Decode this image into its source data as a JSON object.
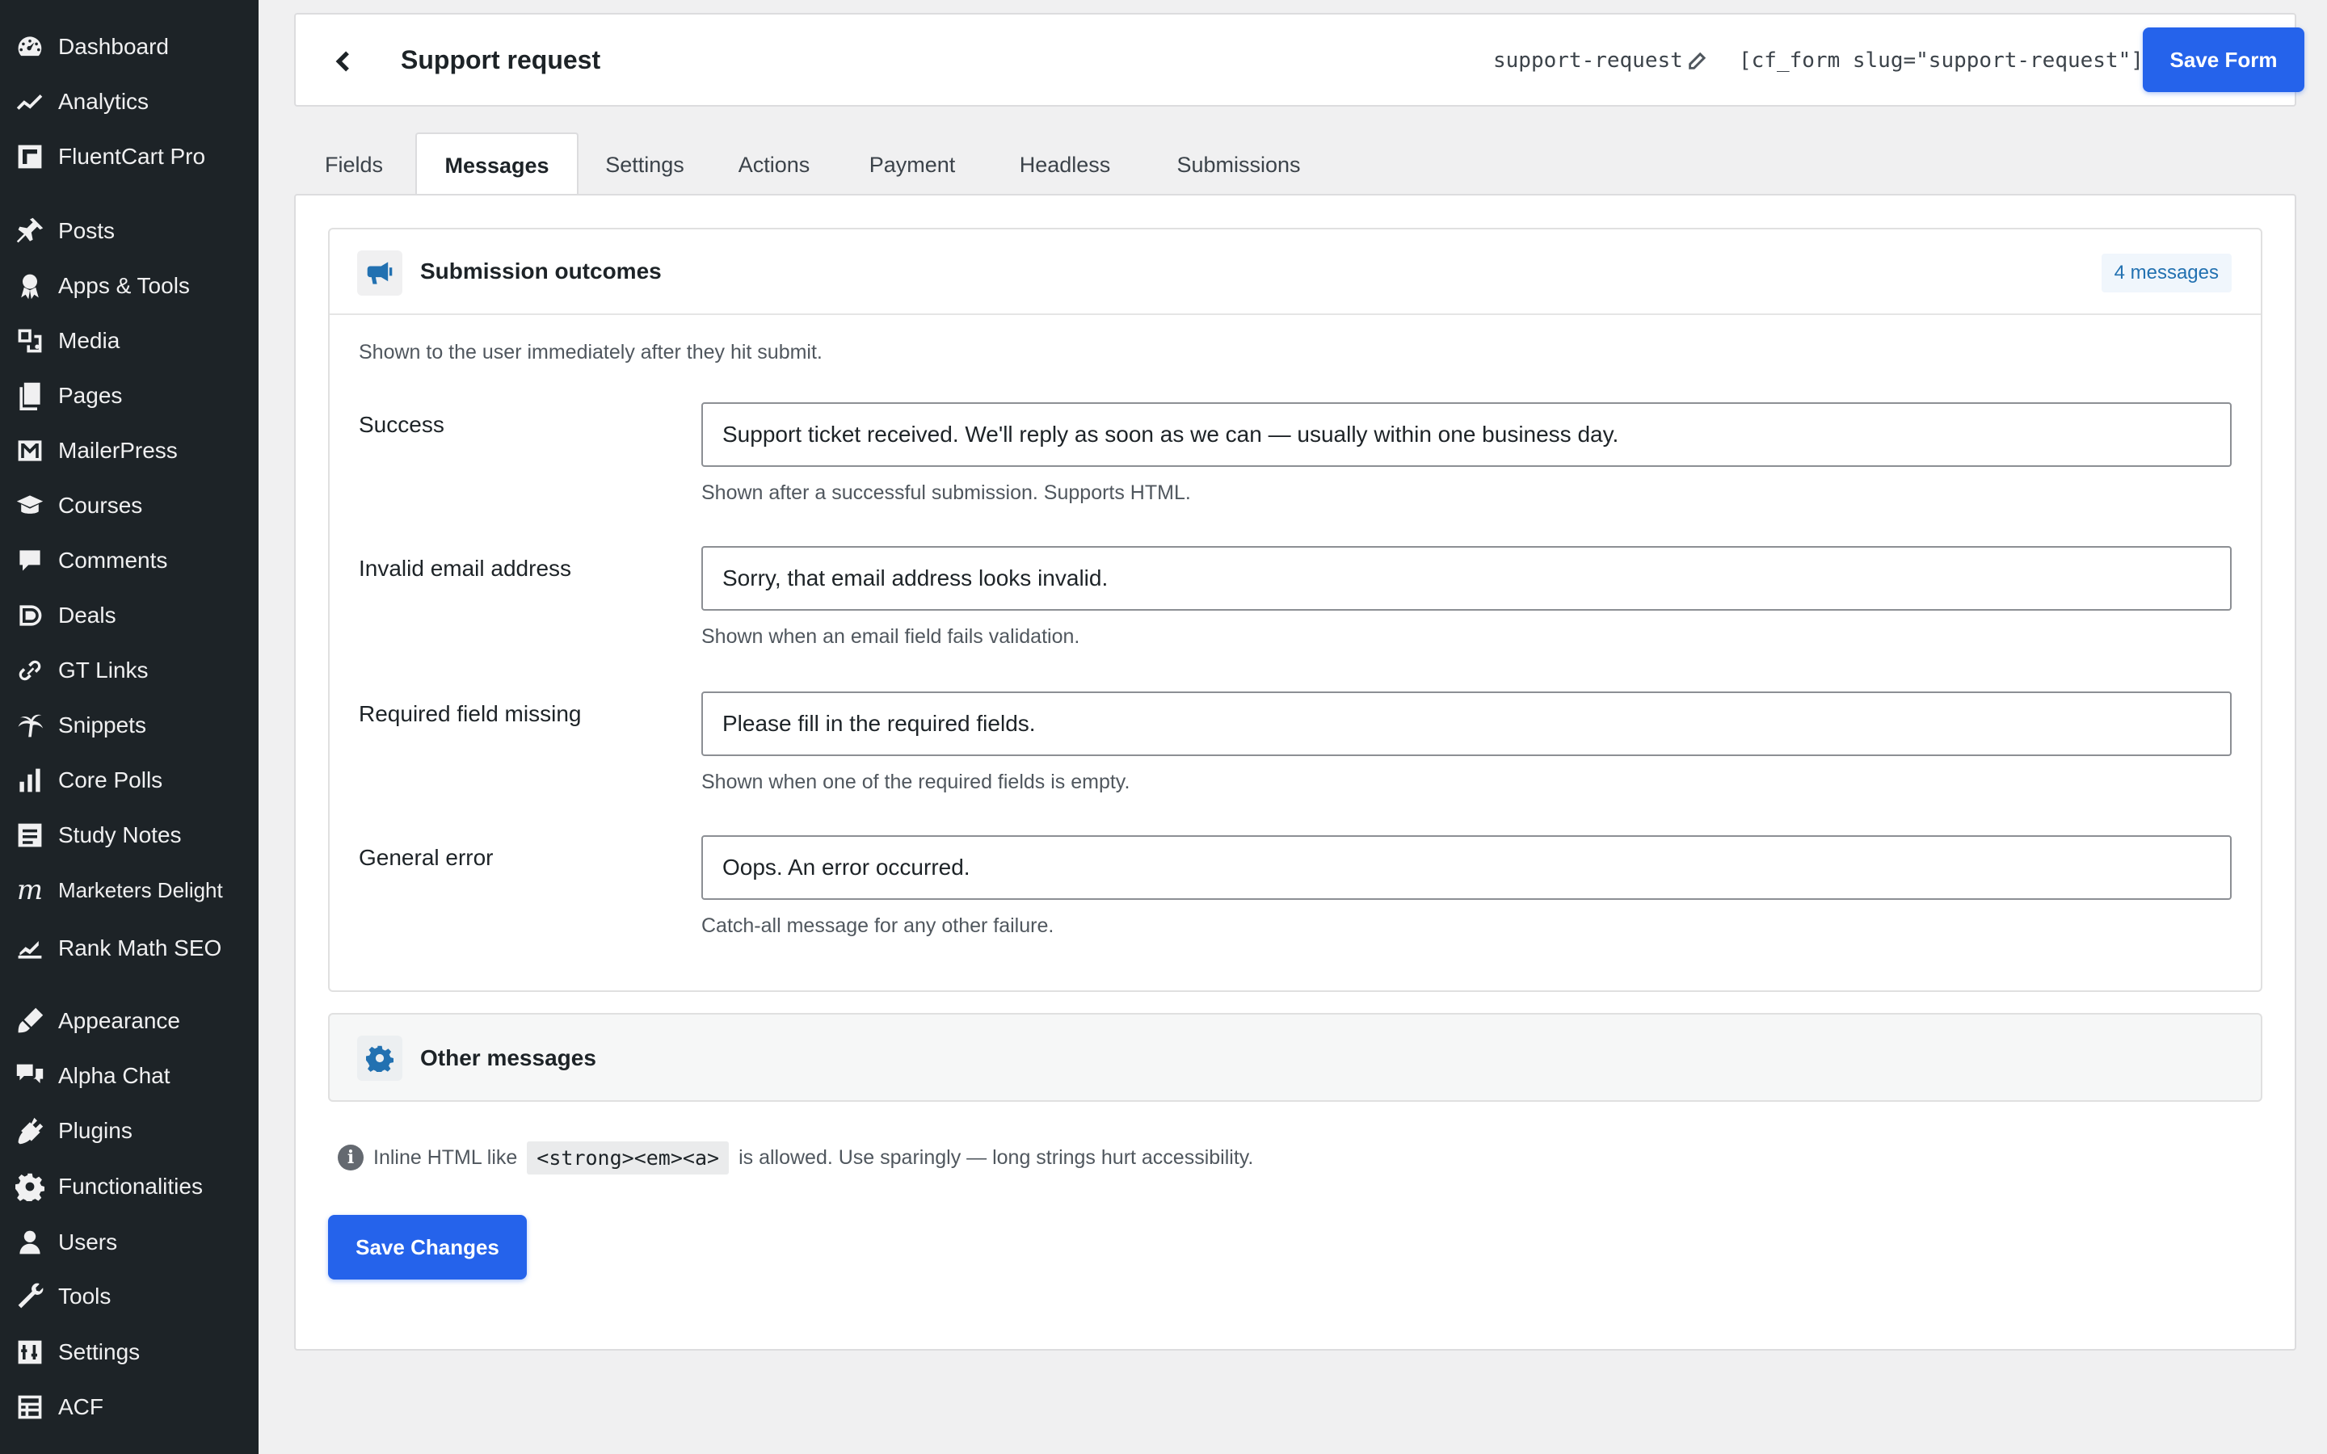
{
  "sidebar": {
    "items": [
      {
        "label": "Dashboard",
        "icon": "dashboard-icon"
      },
      {
        "label": "Analytics",
        "icon": "analytics-icon"
      },
      {
        "label": "FluentCart Pro",
        "icon": "fluentcart-icon"
      },
      {
        "label": "Posts",
        "icon": "pin-icon"
      },
      {
        "label": "Apps & Tools",
        "icon": "award-icon"
      },
      {
        "label": "Media",
        "icon": "media-icon"
      },
      {
        "label": "Pages",
        "icon": "pages-icon"
      },
      {
        "label": "MailerPress",
        "icon": "mailerpress-icon"
      },
      {
        "label": "Courses",
        "icon": "courses-icon"
      },
      {
        "label": "Comments",
        "icon": "comments-icon"
      },
      {
        "label": "Deals",
        "icon": "deals-icon"
      },
      {
        "label": "GT Links",
        "icon": "link-icon"
      },
      {
        "label": "Snippets",
        "icon": "snippets-icon"
      },
      {
        "label": "Core Polls",
        "icon": "polls-icon"
      },
      {
        "label": "Study Notes",
        "icon": "notes-icon"
      },
      {
        "label": "Marketers Delight",
        "icon": "marketers-delight-icon"
      },
      {
        "label": "Rank Math SEO",
        "icon": "rankmath-icon"
      },
      {
        "label": "Appearance",
        "icon": "appearance-icon"
      },
      {
        "label": "Alpha Chat",
        "icon": "chat-icon"
      },
      {
        "label": "Plugins",
        "icon": "plugins-icon"
      },
      {
        "label": "Functionalities",
        "icon": "gear-icon"
      },
      {
        "label": "Users",
        "icon": "users-icon"
      },
      {
        "label": "Tools",
        "icon": "wrench-icon"
      },
      {
        "label": "Settings",
        "icon": "settings-icon"
      },
      {
        "label": "ACF",
        "icon": "acf-icon"
      }
    ]
  },
  "header": {
    "title": "Support request",
    "slug": "support-request",
    "shortcode": "[cf_form slug=\"support-request\"]",
    "save_label": "Save Form"
  },
  "tabs": [
    {
      "label": "Fields"
    },
    {
      "label": "Messages",
      "active": true
    },
    {
      "label": "Settings"
    },
    {
      "label": "Actions"
    },
    {
      "label": "Payment"
    },
    {
      "label": "Headless"
    },
    {
      "label": "Submissions"
    }
  ],
  "outcomes": {
    "title": "Submission outcomes",
    "badge": "4 messages",
    "description": "Shown to the user immediately after they hit submit.",
    "rows": [
      {
        "label": "Success",
        "value": "Support ticket received. We'll reply as soon as we can — usually within one business day.",
        "help": "Shown after a successful submission. Supports HTML."
      },
      {
        "label": "Invalid email address",
        "value": "Sorry, that email address looks invalid.",
        "help": "Shown when an email field fails validation."
      },
      {
        "label": "Required field missing",
        "value": "Please fill in the required fields.",
        "help": "Shown when one of the required fields is empty."
      },
      {
        "label": "General error",
        "value": "Oops. An error occurred.",
        "help": "Catch-all message for any other failure."
      }
    ]
  },
  "other": {
    "title": "Other messages"
  },
  "note": {
    "before": "Inline HTML like",
    "code": "<strong><em><a>",
    "after": "is allowed. Use sparingly — long strings hurt accessibility."
  },
  "save_changes_label": "Save Changes",
  "colors": {
    "accent": "#2563eb",
    "sidebar_bg": "#1d2327",
    "badge_text": "#2271b1"
  }
}
